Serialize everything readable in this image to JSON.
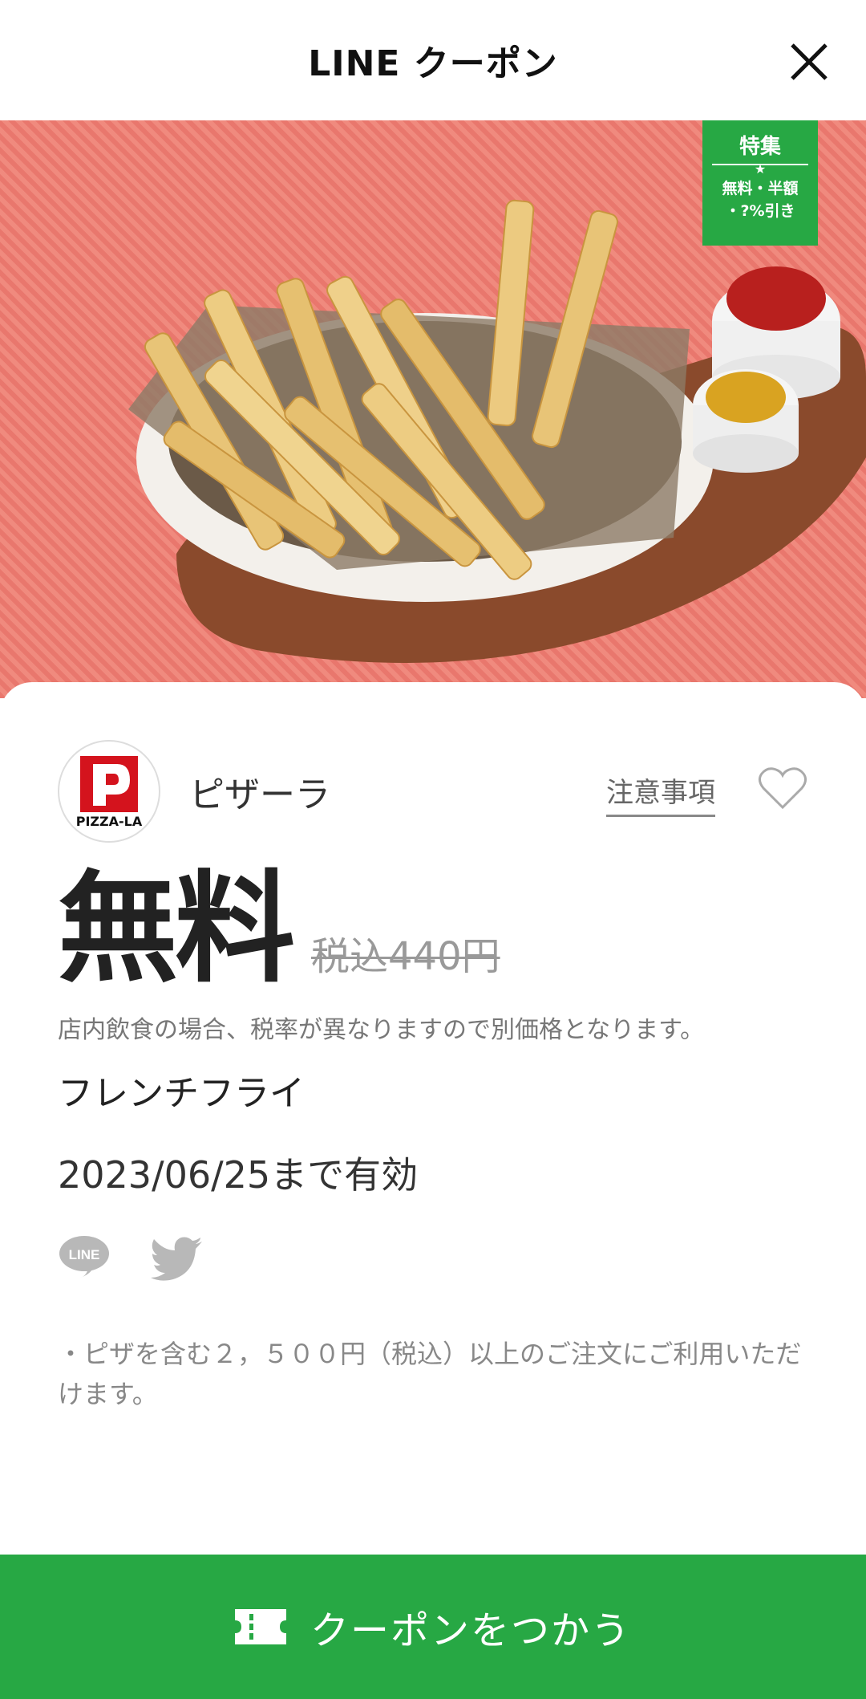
{
  "header": {
    "title": "LINE クーポン"
  },
  "ribbon": {
    "title": "特集",
    "star": "★",
    "line1": "無料・半額",
    "line2": "・?%引き"
  },
  "shop": {
    "name": "ピザーラ",
    "logo_text": "PIZZA-LA",
    "notes_label": "注意事項"
  },
  "coupon": {
    "price": "無料",
    "original_price": "税込440円",
    "tax_note": "店内飲食の場合、税率が異なりますので別価格となります。",
    "item": "フレンチフライ",
    "valid_until": "2023/06/25まで有効",
    "conditions": "・ピザを含む２，５００円（税込）以上のご注文にご利用いただけます。"
  },
  "share": {
    "line_label": "LINE"
  },
  "action": {
    "use_label": "クーポンをつかう"
  },
  "colors": {
    "brand_green": "#27a844",
    "logo_red": "#d4131d"
  }
}
